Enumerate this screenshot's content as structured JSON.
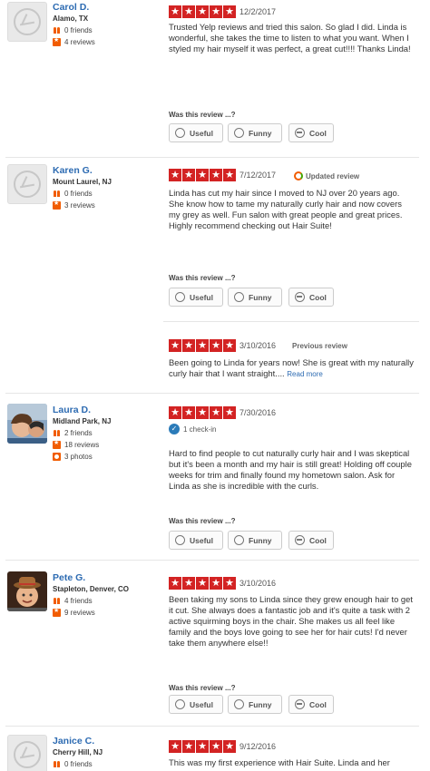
{
  "vote_prompt": "Was this review ...?",
  "votes": {
    "useful": "Useful",
    "funny": "Funny",
    "cool": "Cool"
  },
  "star_glyph": "★",
  "reviews": [
    {
      "name": "Carol D.",
      "location": "Alamo, TX",
      "friends": "0 friends",
      "reviews": "4 reviews",
      "rating": 5,
      "date": "12/2/2017",
      "text": "Trusted Yelp reviews and tried this salon. So glad I did. Linda is wonderful, she takes the time to listen to what you want. When I styled my hair myself it was perfect, a great cut!!!!  Thanks Linda!"
    },
    {
      "name": "Karen G.",
      "location": "Mount Laurel, NJ",
      "friends": "0 friends",
      "reviews": "3 reviews",
      "rating": 5,
      "date": "7/12/2017",
      "badge": "Updated review",
      "text": "Linda has cut my hair since I moved to NJ over 20 years ago.  She know how to tame my naturally curly hair and now covers my grey as well.  Fun salon with great people and great prices.  Highly recommend checking out Hair Suite!",
      "previous": {
        "rating": 5,
        "date": "3/10/2016",
        "badge": "Previous review",
        "text": "Been going to Linda for years now!  She is great with my naturally curly hair that I want straight....",
        "read_more": "Read more"
      }
    },
    {
      "name": "Laura D.",
      "location": "Midland Park, NJ",
      "friends": "2 friends",
      "reviews": "18 reviews",
      "photos": "3 photos",
      "rating": 5,
      "date": "7/30/2016",
      "checkin": "1 check-in",
      "text": "Hard to find people to cut naturally curly hair and I was skeptical but it's been a month and my hair is still great! Holding off couple weeks for trim and finally found my hometown salon. Ask for Linda as she is incredible with the curls."
    },
    {
      "name": "Pete G.",
      "location": "Stapleton, Denver, CO",
      "friends": "4 friends",
      "reviews": "9 reviews",
      "rating": 5,
      "date": "3/10/2016",
      "text": "Been taking my sons to Linda since they grew enough hair to get it cut.  She always does a fantastic job and it's quite a task with 2 active squirming boys in the chair.   She makes us all feel like family and the boys love going to see her for hair cuts!   I'd never take them anywhere else!!"
    },
    {
      "name": "Janice C.",
      "location": "Cherry Hill, NJ",
      "friends": "0 friends",
      "rating": 5,
      "date": "9/12/2016",
      "text": "This was my first experience with Hair Suite.  Linda and her"
    }
  ]
}
